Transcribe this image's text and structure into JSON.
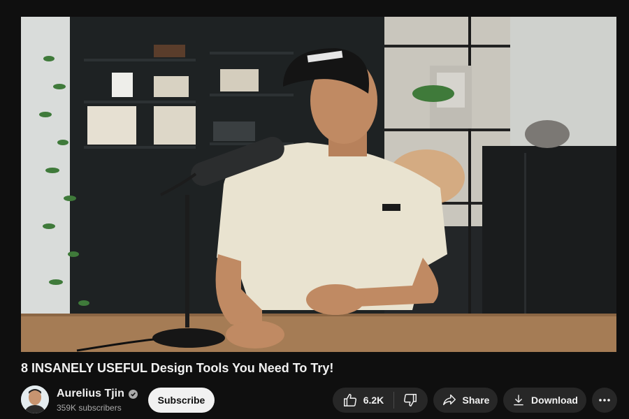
{
  "video": {
    "title": "8 INSANELY USEFUL Design Tools You Need To Try!",
    "thumbnail_description": "man-in-cap-speaking-into-microphone"
  },
  "channel": {
    "name": "Aurelius Tjin",
    "verified": true,
    "subscribers": "359K subscribers",
    "subscribe_label": "Subscribe"
  },
  "actions": {
    "like_count": "6.2K",
    "share_label": "Share",
    "download_label": "Download"
  },
  "colors": {
    "background": "#0f0f0f",
    "pill": "#272727",
    "subscribe_bg": "#f1f1f1",
    "secondary_text": "#aaaaaa"
  },
  "icons": [
    "thumbs-up-icon",
    "thumbs-down-icon",
    "share-arrow-icon",
    "download-icon",
    "more-dots-icon",
    "verified-check-icon"
  ]
}
